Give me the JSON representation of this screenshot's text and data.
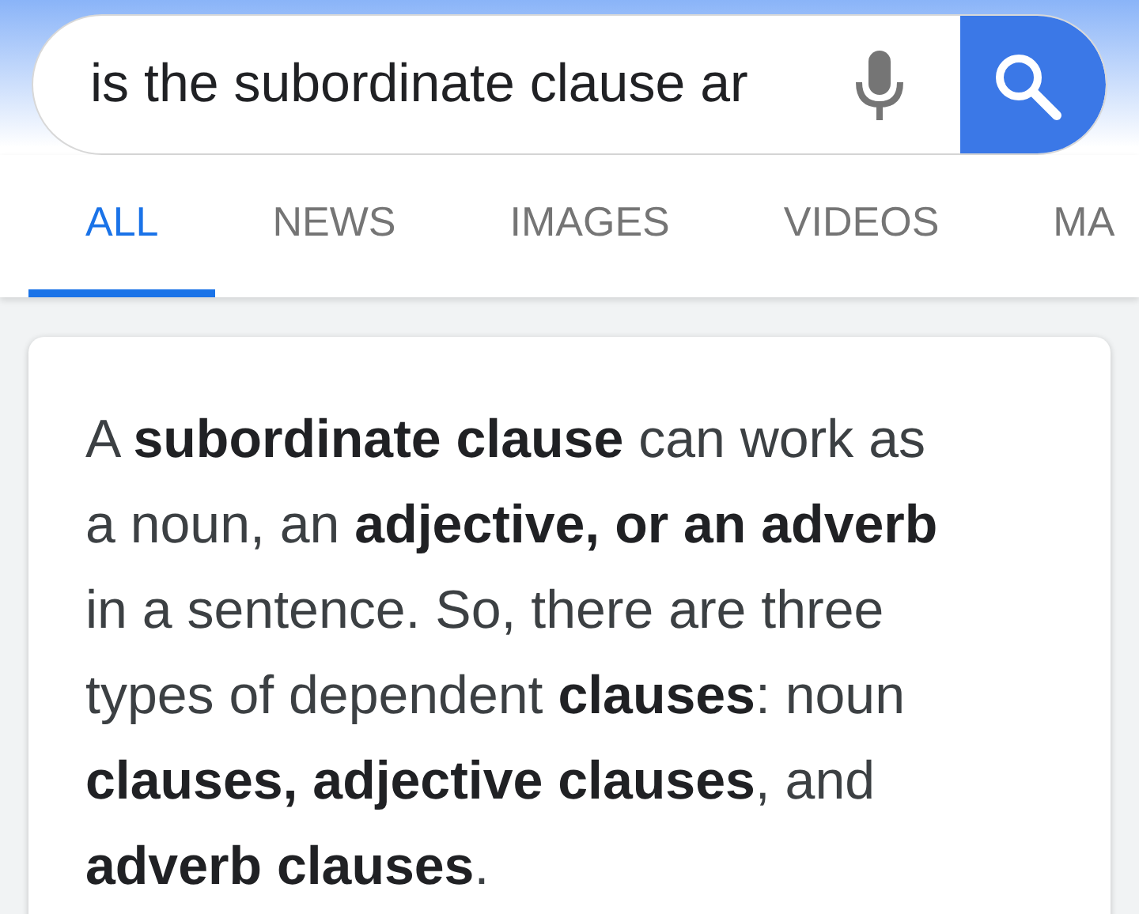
{
  "search": {
    "value": "is the subordinate clause ar"
  },
  "tabs": [
    {
      "label": "ALL",
      "selected": true
    },
    {
      "label": "NEWS",
      "selected": false
    },
    {
      "label": "IMAGES",
      "selected": false
    },
    {
      "label": "VIDEOS",
      "selected": false
    },
    {
      "label": "MA",
      "selected": false
    }
  ],
  "answer": {
    "text": "A **subordinate clause** can work as a noun, an **adjective, or an adverb** in a sentence. So, there are three types of dependent **clauses**: noun **clauses, adjective clauses**, and **adverb clauses**."
  }
}
